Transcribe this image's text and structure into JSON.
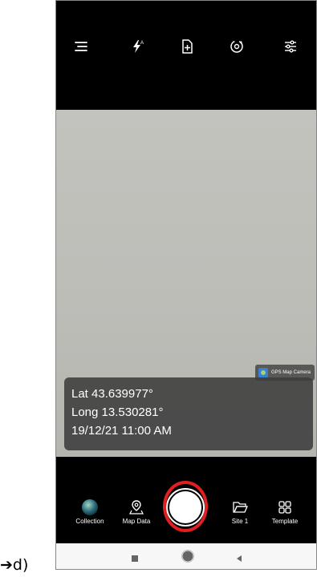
{
  "icons": {
    "menu": "menu-icon",
    "flash": "flash-auto-icon",
    "file_add": "file-add-icon",
    "camera_switch": "camera-switch-icon",
    "settings": "settings-sliders-icon"
  },
  "overlay": {
    "brand_label": "GPS Map Camera",
    "lat": "Lat 43.639977°",
    "long": "Long 13.530281°",
    "datetime": "19/12/21 11:00 AM"
  },
  "bottom": {
    "collection": "Collection",
    "map_data": "Map Data",
    "site": "Site 1",
    "template": "Template"
  },
  "caption": "➔d)",
  "colors": {
    "highlight_ring": "#e02020",
    "viewfinder": "#c0c0bb",
    "bar": "#000000"
  }
}
